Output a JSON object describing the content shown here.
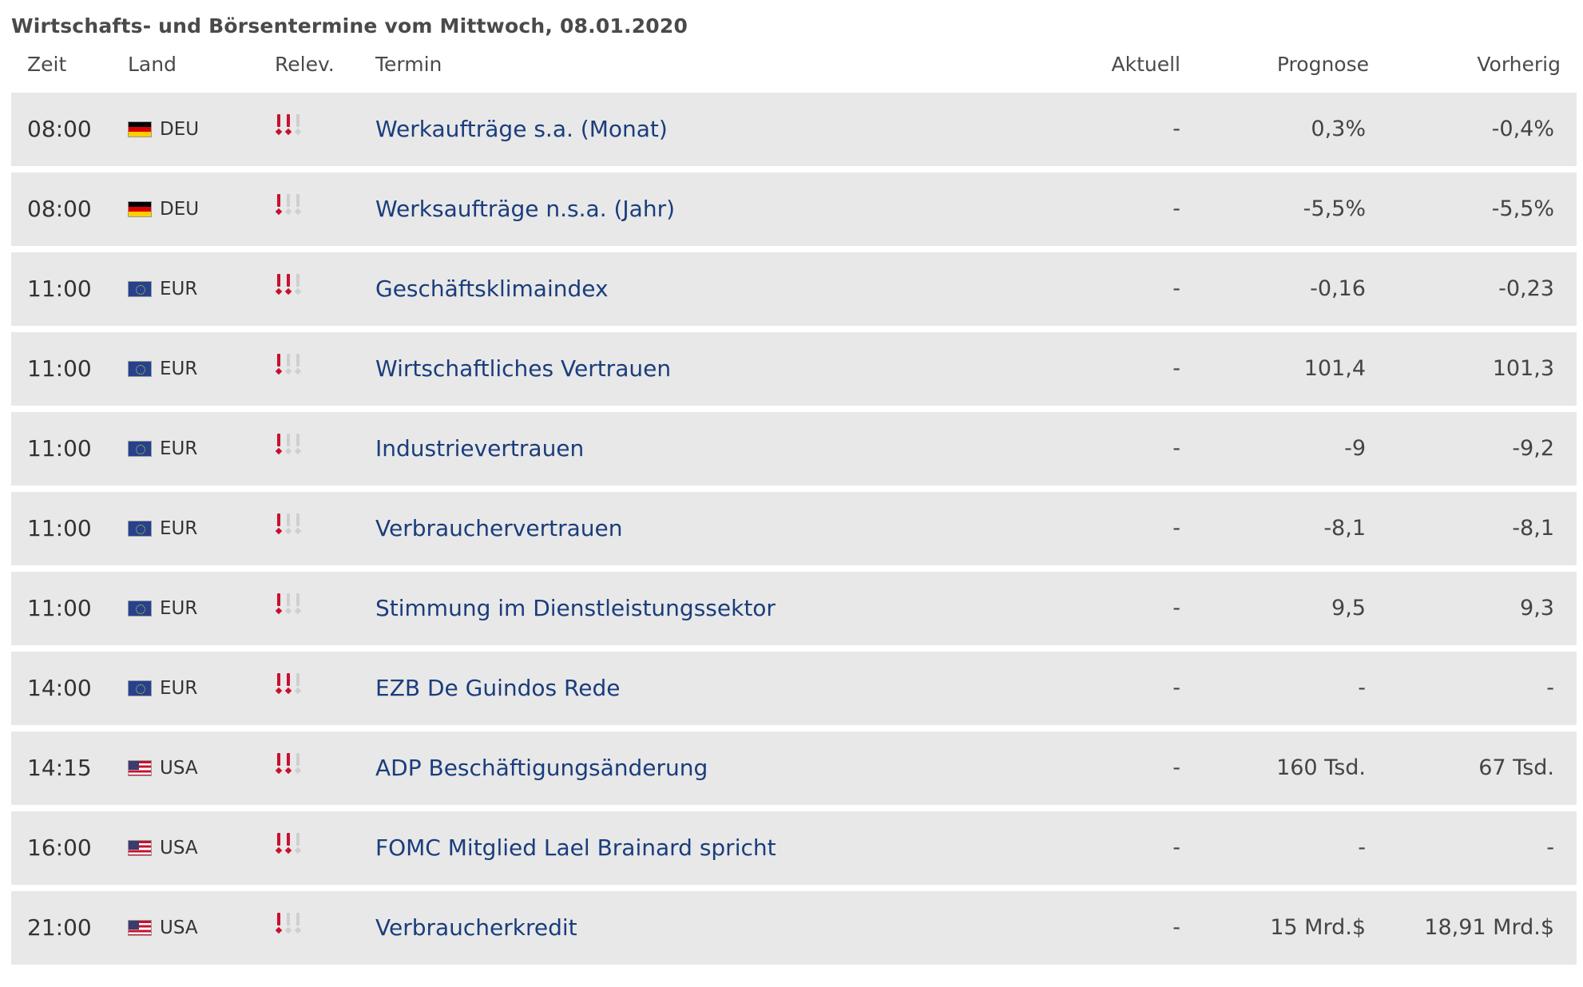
{
  "title": "Wirtschafts- und Börsentermine vom Mittwoch, 08.01.2020",
  "columns": {
    "time": "Zeit",
    "country": "Land",
    "relevance": "Relev.",
    "event": "Termin",
    "actual": "Aktuell",
    "forecast": "Prognose",
    "previous": "Vorherig"
  },
  "colors": {
    "row_bg": "#e8e8e8",
    "event_link": "#1a3d7c",
    "relevance_on": "#c8102e",
    "relevance_off": "#cfcfcf"
  },
  "rows": [
    {
      "time": "08:00",
      "country": "DEU",
      "flag": "germany-flag-icon",
      "relevance": 2,
      "event": "Werkaufträge s.a. (Monat)",
      "actual": "-",
      "forecast": "0,3%",
      "previous": "-0,4%"
    },
    {
      "time": "08:00",
      "country": "DEU",
      "flag": "germany-flag-icon",
      "relevance": 1,
      "event": "Werksaufträge n.s.a. (Jahr)",
      "actual": "-",
      "forecast": "-5,5%",
      "previous": "-5,5%"
    },
    {
      "time": "11:00",
      "country": "EUR",
      "flag": "eu-flag-icon",
      "relevance": 2,
      "event": "Geschäftsklimaindex",
      "actual": "-",
      "forecast": "-0,16",
      "previous": "-0,23"
    },
    {
      "time": "11:00",
      "country": "EUR",
      "flag": "eu-flag-icon",
      "relevance": 1,
      "event": "Wirtschaftliches Vertrauen",
      "actual": "-",
      "forecast": "101,4",
      "previous": "101,3"
    },
    {
      "time": "11:00",
      "country": "EUR",
      "flag": "eu-flag-icon",
      "relevance": 1,
      "event": "Industrievertrauen",
      "actual": "-",
      "forecast": "-9",
      "previous": "-9,2"
    },
    {
      "time": "11:00",
      "country": "EUR",
      "flag": "eu-flag-icon",
      "relevance": 1,
      "event": "Verbrauchervertrauen",
      "actual": "-",
      "forecast": "-8,1",
      "previous": "-8,1"
    },
    {
      "time": "11:00",
      "country": "EUR",
      "flag": "eu-flag-icon",
      "relevance": 1,
      "event": "Stimmung im Dienstleistungssektor",
      "actual": "-",
      "forecast": "9,5",
      "previous": "9,3"
    },
    {
      "time": "14:00",
      "country": "EUR",
      "flag": "eu-flag-icon",
      "relevance": 2,
      "event": "EZB De Guindos Rede",
      "actual": "-",
      "forecast": "-",
      "previous": "-"
    },
    {
      "time": "14:15",
      "country": "USA",
      "flag": "usa-flag-icon",
      "relevance": 2,
      "event": "ADP Beschäftigungsänderung",
      "actual": "-",
      "forecast": "160 Tsd.",
      "previous": "67 Tsd."
    },
    {
      "time": "16:00",
      "country": "USA",
      "flag": "usa-flag-icon",
      "relevance": 2,
      "event": "FOMC Mitglied Lael Brainard spricht",
      "actual": "-",
      "forecast": "-",
      "previous": "-"
    },
    {
      "time": "21:00",
      "country": "USA",
      "flag": "usa-flag-icon",
      "relevance": 1,
      "event": "Verbraucherkredit",
      "actual": "-",
      "forecast": "15 Mrd.$",
      "previous": "18,91 Mrd.$"
    }
  ]
}
